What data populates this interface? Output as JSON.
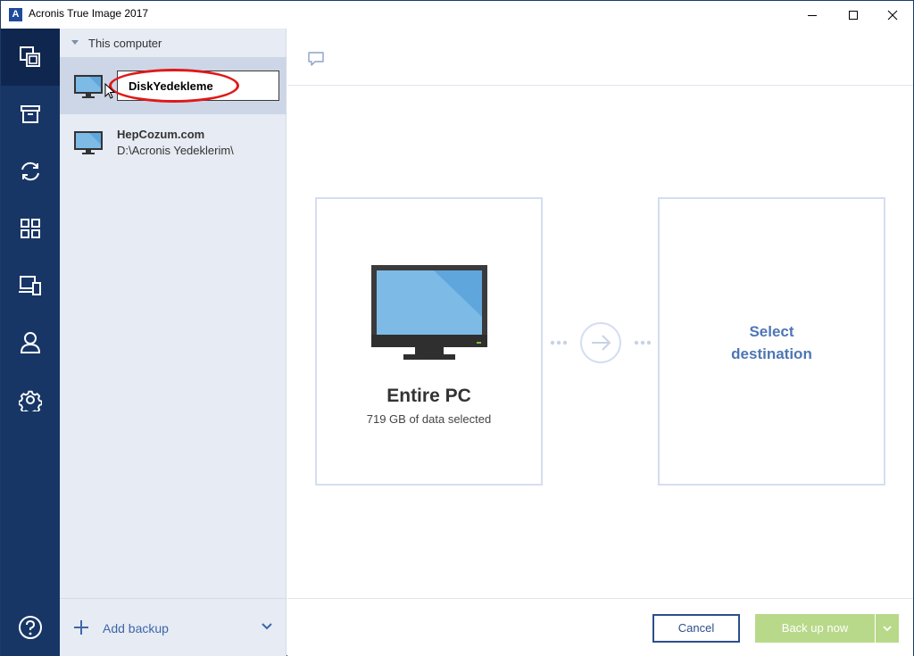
{
  "window": {
    "title": "Acronis True Image 2017",
    "logo_letter": "A"
  },
  "rail": {
    "items": [
      {
        "icon": "backup-copy-icon",
        "active": true
      },
      {
        "icon": "archive-icon",
        "active": false
      },
      {
        "icon": "sync-icon",
        "active": false
      },
      {
        "icon": "dashboard-grid-icon",
        "active": false
      },
      {
        "icon": "devices-icon",
        "active": false
      },
      {
        "icon": "account-icon",
        "active": false
      },
      {
        "icon": "settings-gear-icon",
        "active": false
      }
    ],
    "help_icon": "help-circle-icon",
    "colors": {
      "rail": "#173666",
      "active": "#0f274e"
    }
  },
  "backup_list": {
    "group_label": "This computer",
    "items": [
      {
        "name": "DiskYedekleme",
        "editing": true,
        "selected": true
      },
      {
        "name": "HepCozum.com",
        "path": "D:\\Acronis Yedeklerim\\",
        "selected": false
      }
    ],
    "add_backup_label": "Add backup"
  },
  "source": {
    "title": "Entire PC",
    "subtitle": "719 GB of data selected"
  },
  "destination": {
    "label_line1": "Select",
    "label_line2": "destination"
  },
  "actions": {
    "cancel_label": "Cancel",
    "backup_now_label": "Back up now",
    "backup_now_enabled": false
  },
  "colors": {
    "accent": "#3f66a8",
    "destination_text": "#4d76b5",
    "backup_button": "#b9d98a",
    "highlight_ring": "#e01818"
  }
}
